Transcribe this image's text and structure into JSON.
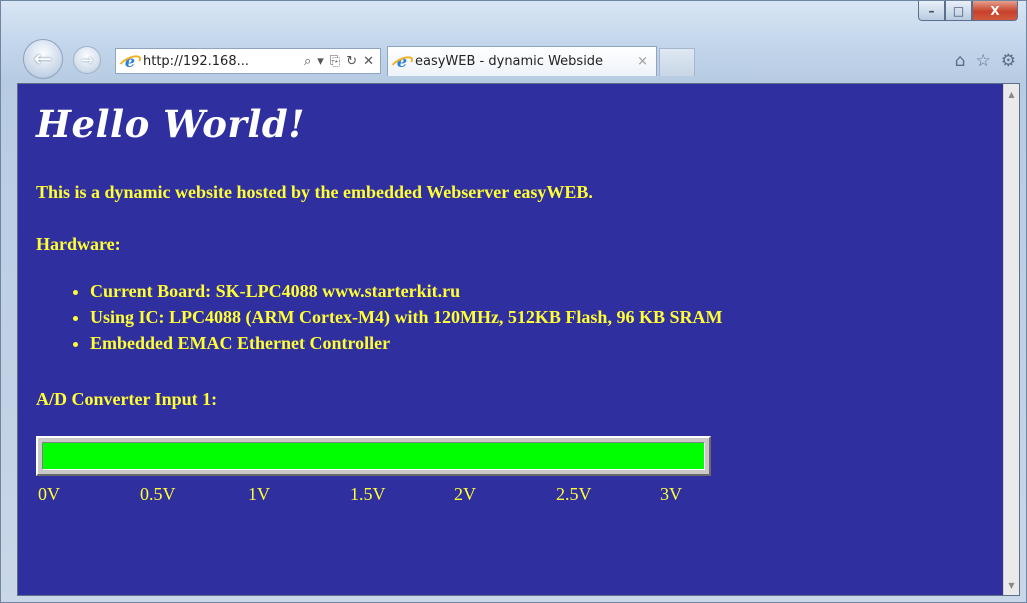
{
  "window": {
    "caption_buttons": {
      "minimize": "–",
      "maximize": "□",
      "close": "X"
    }
  },
  "toolbar": {
    "back_icon": "←",
    "forward_icon": "→",
    "address": {
      "url": "http://192.168...",
      "icons": [
        "search-icon",
        "dropdown-icon",
        "compat-view-icon",
        "refresh-icon",
        "stop-icon"
      ],
      "tools_text": [
        "⌕",
        "▾",
        "⎘",
        "↻",
        "✕"
      ]
    },
    "tab": {
      "title": "easyWEB - dynamic Webside",
      "close": "×"
    },
    "right_icons": [
      "home-icon",
      "favorites-icon",
      "tools-icon"
    ],
    "right_glyphs": [
      "⌂",
      "☆",
      "⚙"
    ]
  },
  "page": {
    "heading": "Hello World!",
    "intro": "This is a dynamic website hosted by the embedded Webserver easyWEB.",
    "hardware_label": "Hardware:",
    "hardware_items": [
      "Current Board: SK-LPC4088 www.starterkit.ru",
      "Using IC: LPC4088 (ARM Cortex-M4) with 120MHz, 512KB Flash, 96 KB SRAM",
      "Embedded EMAC Ethernet Controller"
    ],
    "adc_label": "A/D Converter Input 1:",
    "adc_fraction": 1.0,
    "scale_labels": [
      "0V",
      "0.5V",
      "1V",
      "1.5V",
      "2V",
      "2.5V",
      "3V"
    ]
  },
  "colors": {
    "page_background": "#2f2f9f",
    "text_yellow": "#ffff33",
    "bar_fill": "#00ff00"
  }
}
